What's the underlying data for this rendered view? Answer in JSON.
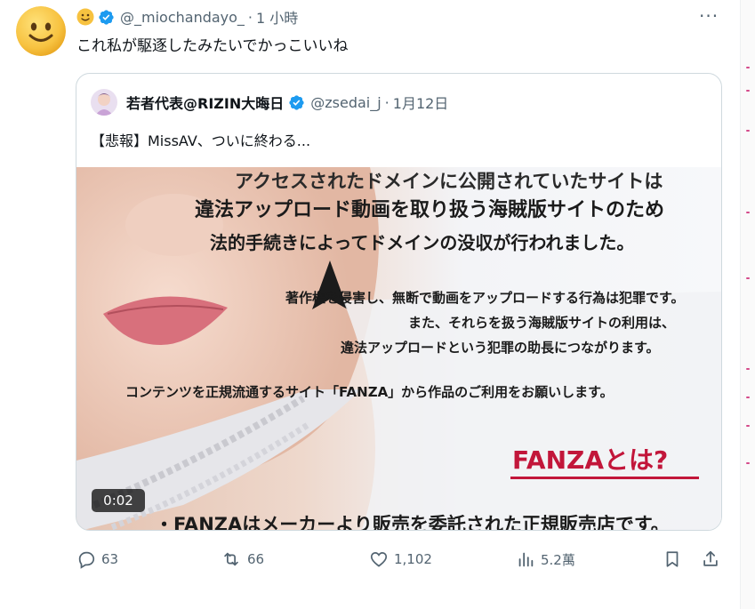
{
  "tweet": {
    "display_name_emoji": "🙂",
    "handle": "@_miochandayo_",
    "separator": "·",
    "time": "1 小時",
    "more_label": "···",
    "text": "これ私が駆逐したみたいでかっこいいね"
  },
  "quoted": {
    "name": "若者代表@RIZIN大晦日",
    "handle": "@zsedai_j",
    "separator": "·",
    "date": "1月12日",
    "text": "【悲報】MissAV、ついに終わる...",
    "video": {
      "timestamp": "0:02",
      "overlay_lines": [
        "アクセスされたドメインに公開されていたサイトは",
        "違法アップロード動画を取り扱う海賊版サイトのため",
        "法的手続きによってドメインの没収が行われました。",
        "著作権を侵害し、無断で動画をアップロードする行為は犯罪です。",
        "また、それらを扱う海賊版サイトの利用は、",
        "違法アップロードという犯罪の助長につながります。",
        "コンテンツを正規流通するサイト「FANZA」から作品のご利用をお願いします。",
        "FANZAとは?",
        "・FANZAはメーカーより販売を委託された正規販売店です。"
      ]
    }
  },
  "actions": {
    "replies": "63",
    "reposts": "66",
    "likes": "1,102",
    "views": "5.2萬"
  },
  "colors": {
    "verified": "#1d9bf0",
    "muted_text": "#536471",
    "card_border": "#cfd9de",
    "fanza_red": "#c2163a"
  },
  "icons": [
    "smiley-avatar-icon",
    "verified-badge-icon",
    "reply-icon",
    "repost-icon",
    "like-icon",
    "views-icon",
    "bookmark-icon",
    "share-icon"
  ]
}
